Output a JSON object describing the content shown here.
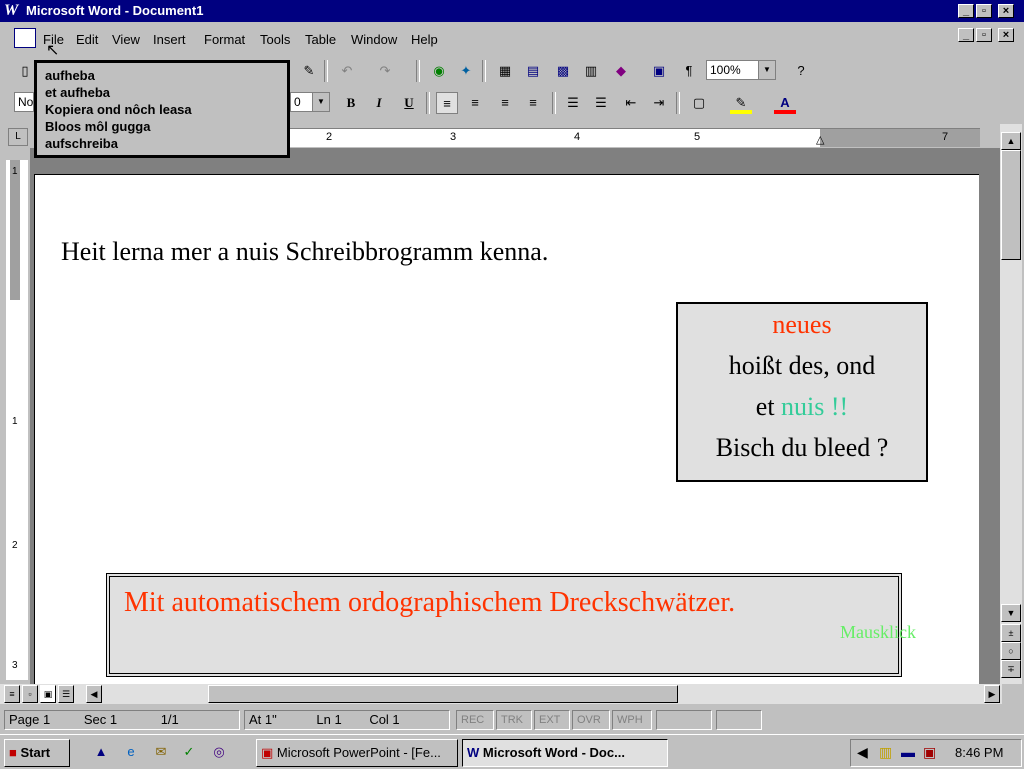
{
  "window": {
    "title": "Microsoft Word - Document1",
    "logo": "W"
  },
  "menu": {
    "items": [
      "File",
      "Edit",
      "View",
      "Insert",
      "Format",
      "Tools",
      "Table",
      "Window",
      "Help"
    ]
  },
  "toolbar": {
    "zoom": "100%",
    "style_partial": "No",
    "size_partial": "0"
  },
  "popup": {
    "lines": [
      "aufheba",
      "et aufheba",
      "Kopiera ond nôch leasa",
      "Bloos môl gugga",
      "aufschreiba"
    ]
  },
  "document": {
    "line1": "Heit lerna mer a nuis Schreibbrogramm kenna.",
    "box1": {
      "line1": "neues",
      "line2": "hoißt des, ond",
      "line3_a": "et",
      "line3_b": "nuis !!",
      "line4": "Bisch du bleed ?"
    },
    "box2": {
      "text": "Mit automatischem ordographischem Dreckschwätzer.",
      "hint": "Mausklick"
    }
  },
  "ruler": {
    "labels": [
      "2",
      "3",
      "4",
      "5",
      "7"
    ],
    "vlabels": [
      "1",
      "1",
      "2",
      "3"
    ]
  },
  "status": {
    "page": "Page  1",
    "sec": "Sec  1",
    "pages": "1/1",
    "at": "At  1\"",
    "ln": "Ln  1",
    "col": "Col  1",
    "rec": "REC",
    "trk": "TRK",
    "ext": "EXT",
    "ovr": "OVR",
    "wph": "WPH"
  },
  "taskbar": {
    "start": "Start",
    "task1": "Microsoft PowerPoint - [Fe...",
    "task2": "Microsoft Word - Doc...",
    "clock": "8:46 PM"
  },
  "colors": {
    "titlebar": "#000080",
    "red_text": "#ff3300",
    "green_text": "#33cc66",
    "hint_text": "#66ee66"
  }
}
